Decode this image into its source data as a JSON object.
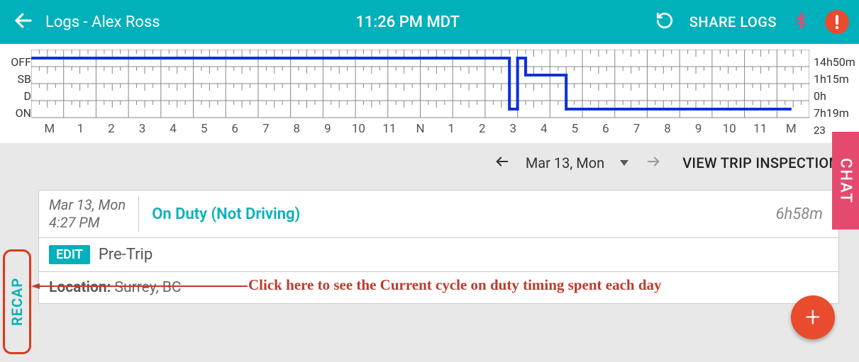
{
  "header": {
    "title": "Logs - Alex Ross",
    "time": "11:26 PM MDT",
    "share_label": "SHARE LOGS"
  },
  "chart_data": {
    "type": "step",
    "y_status": [
      "OFF",
      "SB",
      "D",
      "ON"
    ],
    "x_hours": [
      "M",
      "1",
      "2",
      "3",
      "4",
      "5",
      "6",
      "7",
      "8",
      "9",
      "10",
      "11",
      "N",
      "1",
      "2",
      "3",
      "4",
      "5",
      "6",
      "7",
      "8",
      "9",
      "10",
      "11",
      "M"
    ],
    "durations": {
      "OFF": "14h50m",
      "SB": "1h15m",
      "D": "0h",
      "ON": "7h19m"
    },
    "total": "23",
    "segments": [
      {
        "from_h": 0,
        "to_h": 14.75,
        "status": "OFF"
      },
      {
        "from_h": 14.75,
        "to_h": 15.0,
        "status": "ON"
      },
      {
        "from_h": 15.0,
        "to_h": 15.25,
        "status": "OFF"
      },
      {
        "from_h": 15.25,
        "to_h": 16.5,
        "status": "SB"
      },
      {
        "from_h": 16.5,
        "to_h": 23.45,
        "status": "ON"
      }
    ]
  },
  "datebar": {
    "date_label": "Mar 13, Mon",
    "trip_btn": "VIEW TRIP INSPECTION"
  },
  "card": {
    "date": "Mar 13, Mon",
    "time": "4:27 PM",
    "status": "On Duty (Not Driving)",
    "duration": "6h58m",
    "edit_label": "EDIT",
    "trip_type": "Pre-Trip",
    "location_label": "Location:",
    "location_value": "Surrey, BC"
  },
  "side": {
    "recap": "RECAP",
    "chat": "CHAT"
  },
  "annotation": {
    "text": "Click here to see the Current cycle on duty timing spent each day"
  }
}
